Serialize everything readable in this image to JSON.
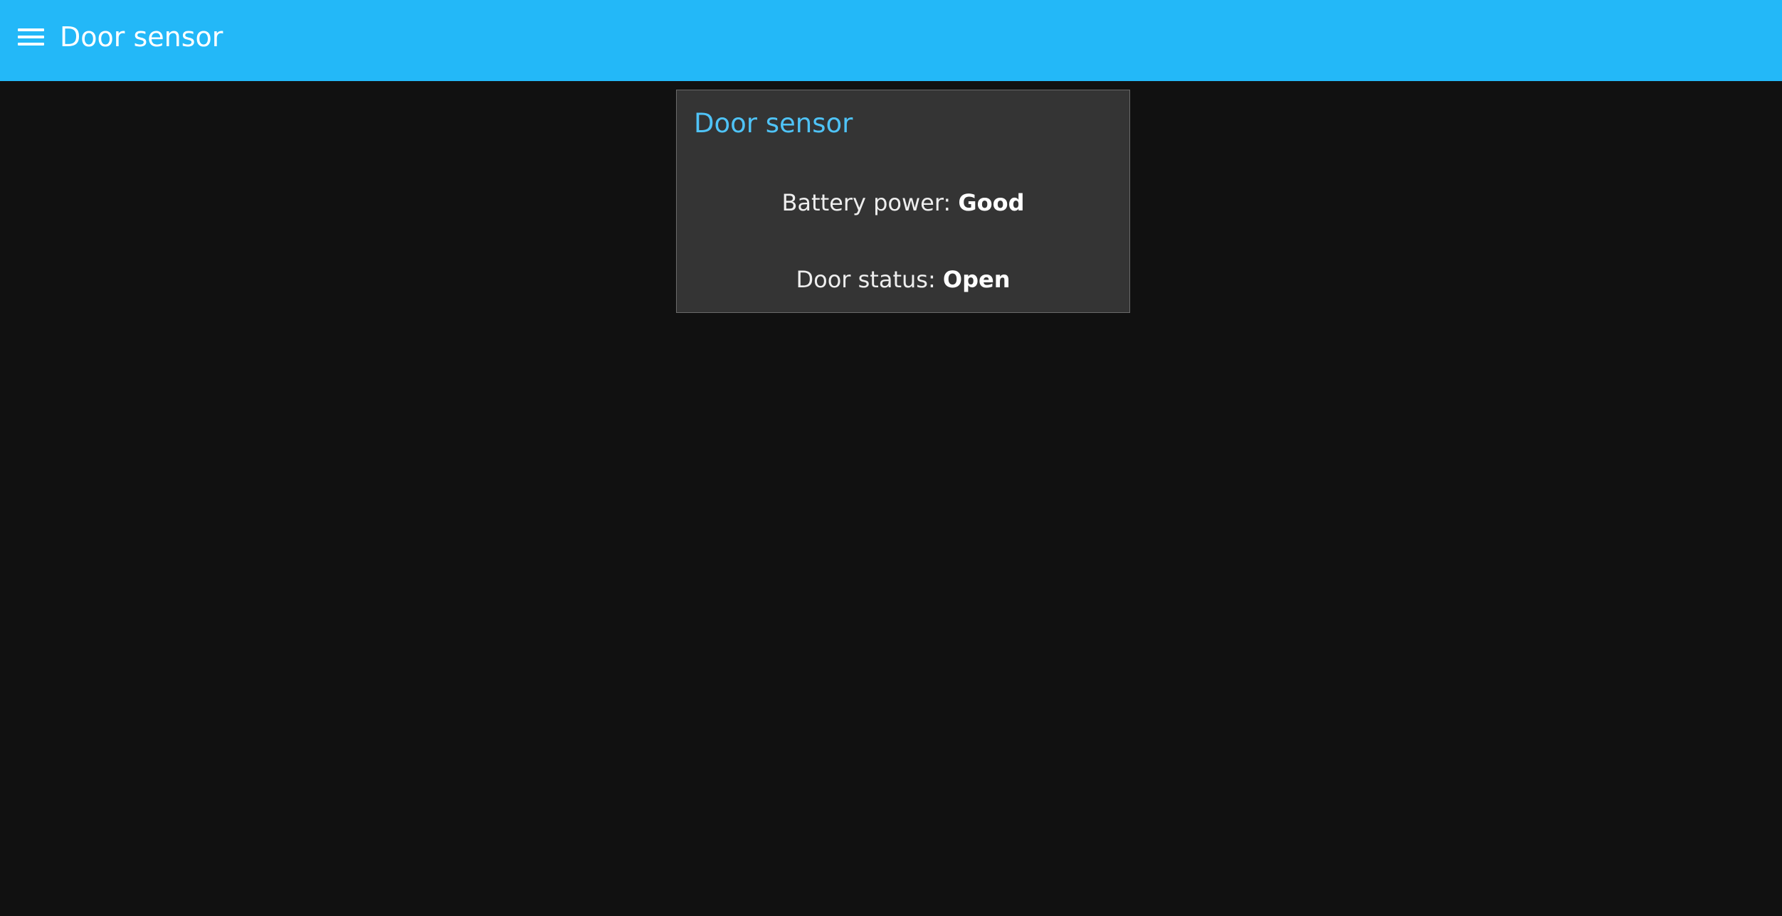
{
  "header": {
    "menu_icon": "hamburger-menu-icon",
    "title": "Door sensor",
    "background_color": "#23b8f8"
  },
  "card": {
    "title": "Door sensor",
    "title_color": "#4fc3f7",
    "battery": {
      "label": "Battery power: ",
      "value": "Good"
    },
    "door": {
      "label": "Door status: ",
      "value": "Open"
    }
  },
  "page": {
    "background_color": "#111111"
  }
}
